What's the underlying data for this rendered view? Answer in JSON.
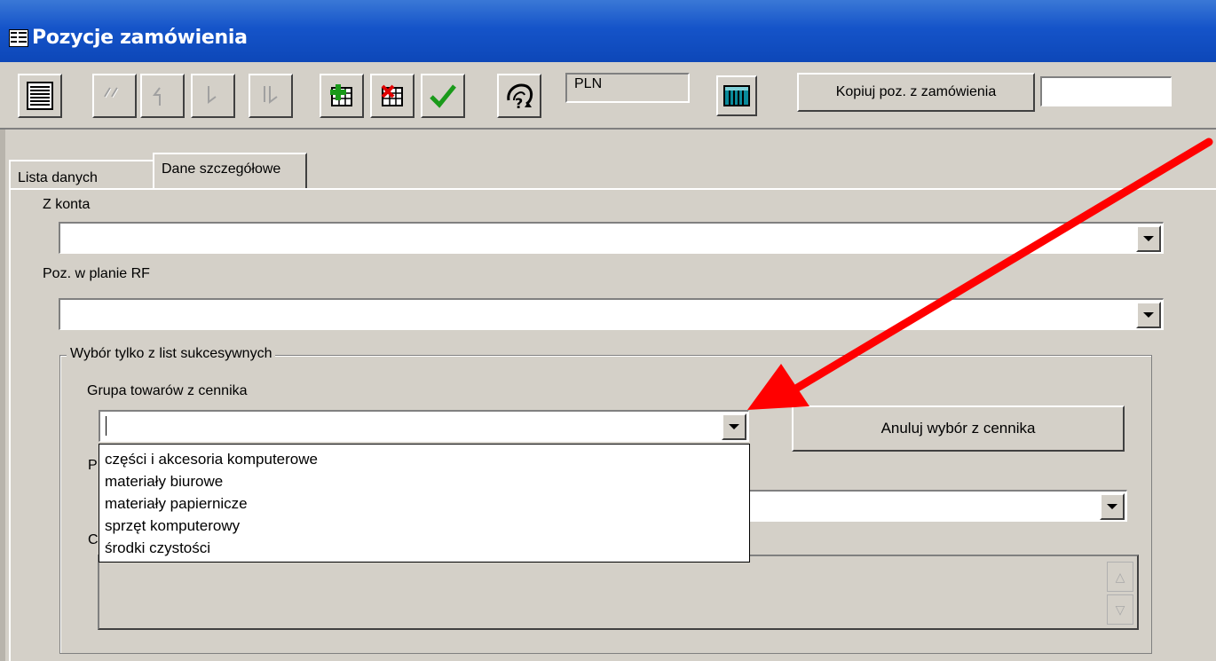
{
  "window": {
    "title": "Pozycje zamówienia",
    "title_icon": "form-icon"
  },
  "toolbar": {
    "buttons": [
      {
        "name": "list-view-button",
        "icon": "list-icon",
        "enabled": true
      },
      {
        "name": "first-record-button",
        "icon": "first-icon",
        "enabled": false
      },
      {
        "name": "previous-record-button",
        "icon": "previous-icon",
        "enabled": false
      },
      {
        "name": "next-record-button",
        "icon": "next-icon",
        "enabled": false
      },
      {
        "name": "last-record-button",
        "icon": "last-icon",
        "enabled": false
      },
      {
        "name": "add-record-button",
        "icon": "add-record-icon",
        "enabled": true
      },
      {
        "name": "delete-record-button",
        "icon": "delete-record-icon",
        "enabled": true
      },
      {
        "name": "confirm-button",
        "icon": "checkmark-icon",
        "enabled": true
      },
      {
        "name": "help-button",
        "icon": "help-icon",
        "enabled": true
      },
      {
        "name": "calculator-button",
        "icon": "calculator-icon",
        "enabled": true
      }
    ],
    "currency": "PLN",
    "copy_button_label": "Kopiuj poz. z zamówienia",
    "copy_input_value": ""
  },
  "tabs": [
    {
      "label": "Lista danych",
      "active": false
    },
    {
      "label": "Dane szczegółowe",
      "active": true
    }
  ],
  "form": {
    "z_konta_label": "Z konta",
    "z_konta_value": "",
    "poz_w_planie_label": "Poz. w planie RF",
    "poz_w_planie_value": "",
    "groupbox_title": "Wybór tylko z list sukcesywnych",
    "grupa_label": "Grupa towarów z cennika",
    "grupa_value": "",
    "anuluj_label": "Anuluj wybór z cennika",
    "hidden_label_1": "P",
    "hidden_label_2": "C"
  },
  "dropdown": {
    "options": [
      "części i akcesoria komputerowe",
      "materiały biurowe",
      "materiały papiernicze",
      "sprzęt komputerowy",
      "środki czystości"
    ]
  },
  "colors": {
    "titlebar": "#1554c9",
    "face": "#d4d0c8",
    "annotation_arrow": "#ff0000"
  }
}
